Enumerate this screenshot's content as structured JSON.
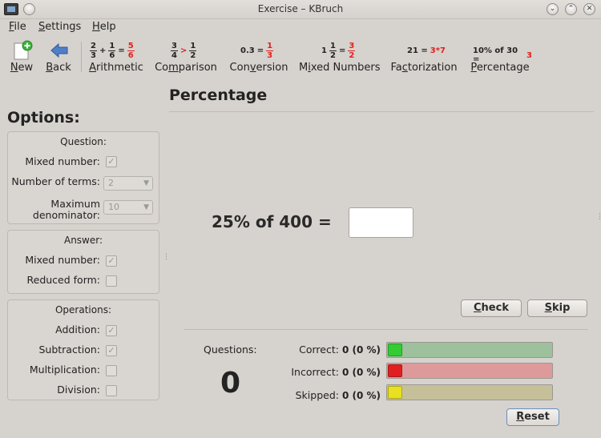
{
  "window": {
    "title": "Exercise – KBruch"
  },
  "menu": [
    {
      "mnemonic": "F",
      "rest": "ile"
    },
    {
      "mnemonic": "S",
      "rest": "ettings"
    },
    {
      "mnemonic": "H",
      "rest": "elp"
    }
  ],
  "toolbar": {
    "new": {
      "mnemonic": "N",
      "rest": "ew",
      "icon": "new-document-plus-icon"
    },
    "back": {
      "mnemonic": "B",
      "rest": "ack",
      "icon": "back-arrow-icon"
    },
    "arithmetic": {
      "mnemonic": "A",
      "rest": "rithmetic",
      "icon": {
        "a_num": "2",
        "a_den": "3",
        "op1": "+",
        "b_num": "1",
        "b_den": "6",
        "eq": "=",
        "r_num": "5",
        "r_den": "6"
      }
    },
    "comparison": {
      "pre": "Co",
      "mnemonic": "m",
      "rest": "parison",
      "icon": {
        "a_num": "3",
        "a_den": "4",
        "op": ">",
        "b_num": "1",
        "b_den": "2"
      }
    },
    "conversion": {
      "pre": "Con",
      "mnemonic": "v",
      "rest": "ersion",
      "icon": {
        "dec": "0.3",
        "eq": "=",
        "r_num": "1",
        "r_den": "3"
      }
    },
    "mixed": {
      "pre": "M",
      "mnemonic": "i",
      "rest": "xed Numbers",
      "icon": {
        "whole": "1",
        "a_num": "1",
        "a_den": "2",
        "eq": "=",
        "r_num": "3",
        "r_den": "2"
      }
    },
    "factorization": {
      "pre": "Fa",
      "mnemonic": "c",
      "rest": "torization",
      "icon": {
        "lhs": "21 =",
        "rhs": "3*7"
      }
    },
    "percentage": {
      "mnemonic": "P",
      "rest": "ercentage",
      "icon": {
        "lhs": "10% of 30 =",
        "rhs": "3"
      }
    }
  },
  "options": {
    "title": "Options:",
    "question": {
      "title": "Question:",
      "mixed_label": "Mixed number:",
      "mixed_checked": true,
      "terms_label": "Number of terms:",
      "terms_value": "2",
      "maxden_label_1": "Maximum",
      "maxden_label_2": "denominator:",
      "maxden_value": "10"
    },
    "answer": {
      "title": "Answer:",
      "mixed_label": "Mixed number:",
      "mixed_checked": true,
      "reduced_label": "Reduced form:",
      "reduced_checked": false
    },
    "operations": {
      "title": "Operations:",
      "addition_label": "Addition:",
      "addition_checked": true,
      "subtraction_label": "Subtraction:",
      "subtraction_checked": true,
      "multiplication_label": "Multiplication:",
      "multiplication_checked": false,
      "division_label": "Division:",
      "division_checked": false
    }
  },
  "task": {
    "title": "Percentage",
    "question": "25% of 400 =",
    "answer_value": "",
    "check": {
      "mnemonic": "C",
      "rest": "heck"
    },
    "skip": {
      "mnemonic": "S",
      "rest": "kip"
    }
  },
  "stats": {
    "questions_label": "Questions:",
    "questions_count": "0",
    "correct_label": "Correct:",
    "correct_value": "0 (0 %)",
    "incorrect_label": "Incorrect:",
    "incorrect_value": "0 (0 %)",
    "skipped_label": "Skipped:",
    "skipped_value": "0 (0 %)",
    "correct_fraction": 0,
    "incorrect_fraction": 0,
    "skipped_fraction": 0,
    "reset": {
      "mnemonic": "R",
      "rest": "eset"
    },
    "colors": {
      "correct": "#33cc33",
      "incorrect": "#e02020",
      "skipped": "#e8e020"
    }
  }
}
